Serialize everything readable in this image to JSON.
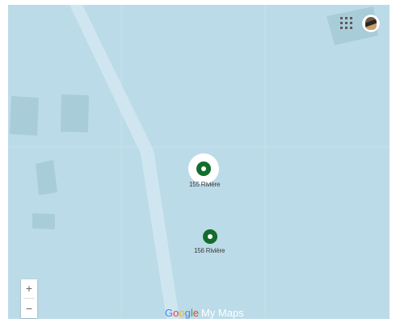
{
  "map": {
    "background_color": "#bcdbe8",
    "building_color": "#a9ccd9",
    "road_color": "#cfe6f0"
  },
  "controls": {
    "apps_icon": "apps-grid-icon",
    "avatar_icon": "user-avatar-icon",
    "zoom_in_label": "+",
    "zoom_out_label": "−"
  },
  "markers": [
    {
      "label": "155 Rivière",
      "color": "#146c2e",
      "selected": true
    },
    {
      "label": "156 Rivière",
      "color": "#146c2e",
      "selected": false
    }
  ],
  "branding": {
    "google_letters": [
      "G",
      "o",
      "o",
      "g",
      "l",
      "e"
    ],
    "product": "My Maps"
  }
}
